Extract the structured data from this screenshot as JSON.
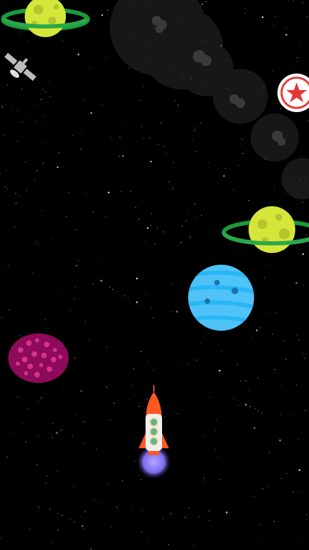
{
  "game": {
    "screen": "space-flight",
    "background_color": "#000000",
    "accent_color": "#e53935"
  },
  "objects": {
    "ringed_planet_top": {
      "icon": "ringed-planet",
      "planet_color": "#d4e63a",
      "ring_color": "#1b9a3a"
    },
    "satellite": {
      "icon": "satellite",
      "color": "#bdbdbd"
    },
    "star_badge": {
      "icon": "star-badge",
      "color": "#e53935"
    },
    "ringed_planet_right": {
      "icon": "ringed-planet",
      "planet_color": "#d4e63a",
      "ring_color": "#1b9a3a"
    },
    "blue_planet": {
      "icon": "striped-planet",
      "color": "#4fc3f7"
    },
    "magenta_planet": {
      "icon": "spotted-planet",
      "color": "#8e0a5a"
    },
    "rocket": {
      "icon": "rocket",
      "body_color": "#eeeeee",
      "nose_color": "#ff5722",
      "flame_color": "#8c7cf0"
    }
  }
}
